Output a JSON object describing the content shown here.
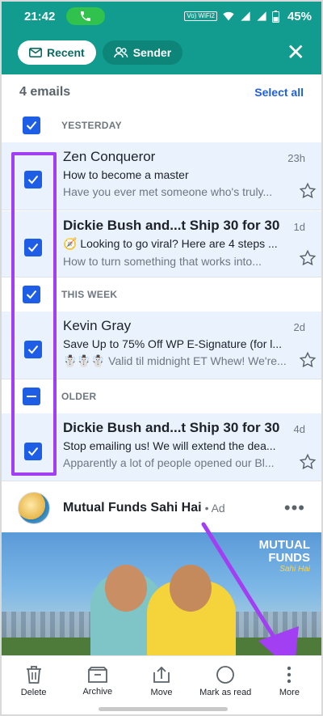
{
  "status_bar": {
    "time": "21:42",
    "network_tag": "Vo) WiFi2",
    "battery": "45%"
  },
  "filters": {
    "recent_label": "Recent",
    "sender_label": "Sender"
  },
  "list_header": {
    "count": "4 emails",
    "select_all": "Select all"
  },
  "sections": {
    "yesterday": "YESTERDAY",
    "this_week": "THIS WEEK",
    "older": "OLDER"
  },
  "emails": [
    {
      "sender": "Zen Conqueror",
      "time": "23h",
      "subject": "How to become a master",
      "preview": "Have you ever met someone who's truly...",
      "unread": false
    },
    {
      "sender": "Dickie Bush and...t Ship 30 for 30",
      "time": "1d",
      "subject": "🧭 Looking to go viral? Here are 4 steps ...",
      "preview": "How to turn something that works into...",
      "unread": true
    },
    {
      "sender": "Kevin Gray",
      "time": "2d",
      "subject": "Save Up to 75% Off WP E-Signature (for l...",
      "preview": "☃️☃️☃️ Valid til midnight ET Whew! We're...",
      "unread": false
    },
    {
      "sender": "Dickie Bush and...t Ship 30 for 30",
      "time": "4d",
      "subject": "Stop emailing us! We will extend the dea...",
      "preview": "Apparently a lot of people opened our Bl...",
      "unread": true
    }
  ],
  "ad": {
    "title": "Mutual Funds Sahi Hai",
    "tag": "• Ad",
    "banner_line1": "MUTUAL",
    "banner_line2": "FUNDS",
    "banner_line3": "Sahi Hai"
  },
  "actions": [
    {
      "label": "Delete",
      "icon": "trash-icon"
    },
    {
      "label": "Archive",
      "icon": "archive-icon"
    },
    {
      "label": "Move",
      "icon": "move-icon"
    },
    {
      "label": "Mark as read",
      "icon": "circle-icon"
    },
    {
      "label": "More",
      "icon": "more-vertical-icon"
    }
  ],
  "colors": {
    "accent": "#119c8f",
    "checkbox": "#1e5ee6",
    "selected_row": "#eaf2fd",
    "highlight": "#a23ff2"
  }
}
